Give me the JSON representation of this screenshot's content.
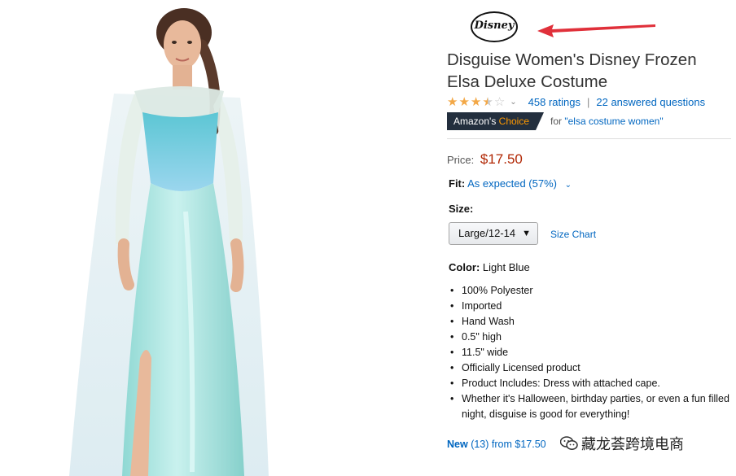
{
  "brand": {
    "logo_text": "Disney"
  },
  "product": {
    "title": "Disguise Women's Disney Frozen Elsa Deluxe Costume",
    "rating_stars": 3.5,
    "rating_chevron": "⌄",
    "ratings_count": "458 ratings",
    "separator": "|",
    "answered_questions": "22 answered questions",
    "badge_prefix": "Amazon's",
    "badge_choice": "Choice",
    "badge_for": "for",
    "badge_keyword": "\"elsa costume women\"",
    "price_label": "Price:",
    "price": "$17.50",
    "fit_label": "Fit:",
    "fit_value": "As expected (57%)",
    "size_label": "Size:",
    "size_selected": "Large/12-14",
    "size_chart": "Size Chart",
    "color_label": "Color:",
    "color_value": "Light Blue",
    "bullets": [
      "100% Polyester",
      "Imported",
      "Hand Wash",
      "0.5\" high",
      "11.5\" wide",
      "Officially Licensed product",
      "Product Includes: Dress with attached cape.",
      "Whether it's Halloween, birthday parties, or even a fun filled night, disguise is good for everything!"
    ],
    "new_label": "New",
    "new_count": "(13)",
    "new_from": "from $17.50"
  },
  "watermark": {
    "text": "藏龙荟跨境电商"
  },
  "colors": {
    "link": "#0066c0",
    "price": "#b12704",
    "star": "#f3a847",
    "badge_bg": "#232f3e",
    "badge_accent": "#ff9900",
    "arrow": "#e0303a",
    "dress": "#a9e4e0"
  },
  "icons": [
    "star-icon",
    "chevron-down-icon",
    "red-arrow-icon",
    "wechat-icon"
  ]
}
